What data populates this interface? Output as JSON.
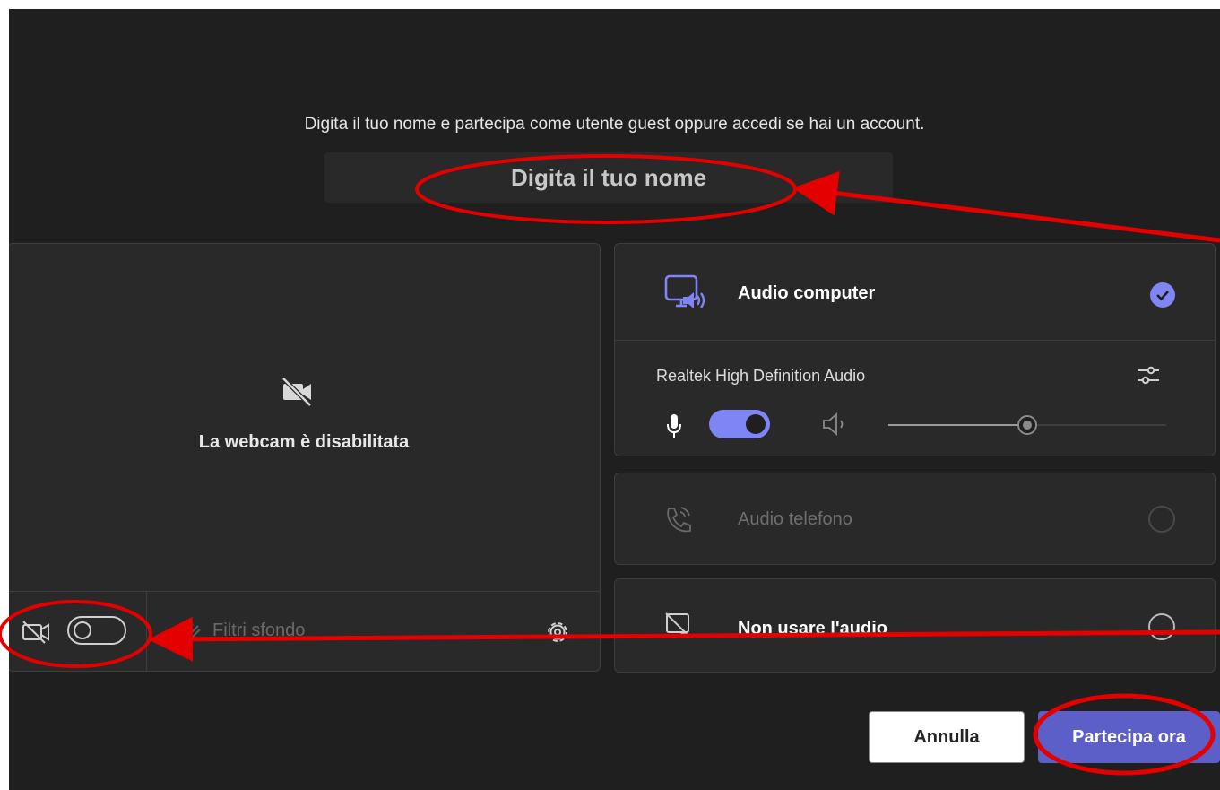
{
  "prejoin": {
    "instruction": "Digita il tuo nome e partecipa come utente guest oppure accedi se hai un account.",
    "name_placeholder": "Digita il tuo nome",
    "name_value": ""
  },
  "video": {
    "camera_status": "La webcam è disabilitata",
    "camera_enabled": false,
    "background_filters_label": "Filtri sfondo"
  },
  "audio": {
    "options": [
      {
        "label": "Audio computer",
        "selected": true,
        "enabled": true
      },
      {
        "label": "Audio telefono",
        "selected": false,
        "enabled": false
      },
      {
        "label": "Non usare l'audio",
        "selected": false,
        "enabled": true
      }
    ],
    "device_name": "Realtek High Definition Audio",
    "mic_enabled": true,
    "speaker_volume": 0.5
  },
  "buttons": {
    "cancel_label": "Annulla",
    "join_label": "Partecipa ora"
  },
  "colors": {
    "background": "#1f1f1f",
    "panel": "#292929",
    "accent": "#7f85f5",
    "join_button": "#5b5fc7",
    "annotation": "#e50000"
  },
  "icons": [
    "camera-off-icon",
    "background-effects-icon",
    "settings-gear-icon",
    "computer-audio-icon",
    "phone-audio-icon",
    "no-audio-icon",
    "checkmark-icon",
    "device-settings-icon",
    "microphone-icon",
    "speaker-icon"
  ]
}
